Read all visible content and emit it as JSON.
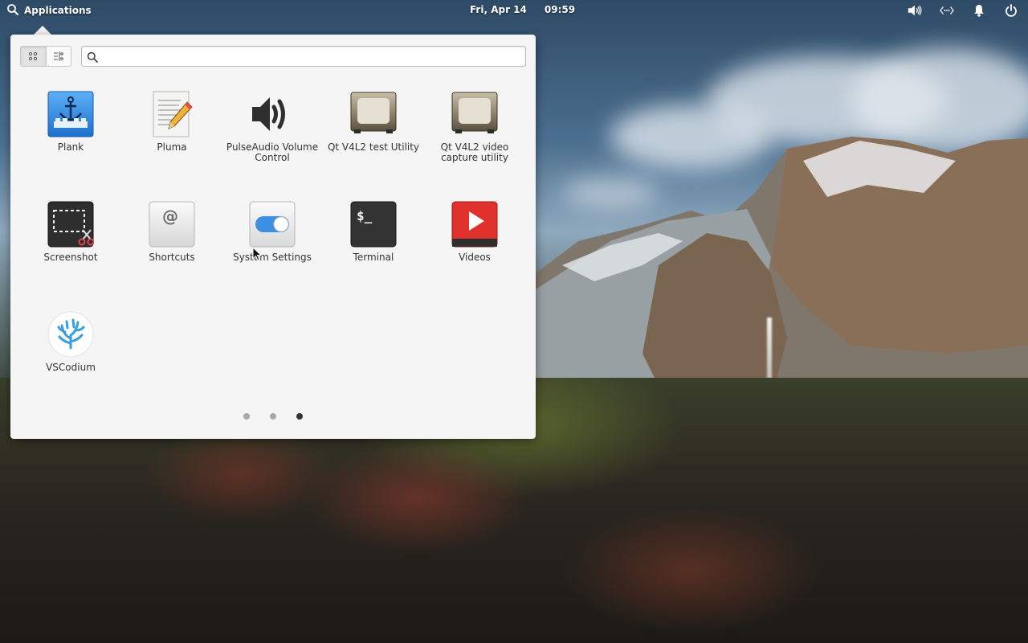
{
  "panel": {
    "applications_label": "Applications",
    "date": "Fri, Apr 14",
    "time": "09:59",
    "indicators": [
      "speaker-icon",
      "network-icon",
      "bell-icon",
      "power-icon"
    ]
  },
  "menu": {
    "view_modes": [
      "grid-view-icon",
      "category-view-icon"
    ],
    "active_view": "grid",
    "search": {
      "value": "",
      "placeholder": ""
    },
    "apps": [
      {
        "label": "Plank",
        "icon": "plank-icon"
      },
      {
        "label": "Pluma",
        "icon": "pluma-icon"
      },
      {
        "label": "PulseAudio Volume Control",
        "icon": "speaker-icon"
      },
      {
        "label": "Qt V4L2 test Utility",
        "icon": "webcam-icon"
      },
      {
        "label": "Qt V4L2 video capture utility",
        "icon": "webcam-icon"
      },
      {
        "label": "Screenshot",
        "icon": "screenshot-icon"
      },
      {
        "label": "Shortcuts",
        "icon": "at-sign-icon"
      },
      {
        "label": "System Settings",
        "icon": "toggle-switch-icon"
      },
      {
        "label": "Terminal",
        "icon": "terminal-icon"
      },
      {
        "label": "Videos",
        "icon": "video-play-icon"
      },
      {
        "label": "VSCodium",
        "icon": "vscodium-icon"
      }
    ],
    "pages": {
      "total": 3,
      "current": 3
    }
  },
  "colors": {
    "menu_bg": "#f5f5f5",
    "label_text": "#333333",
    "videos_red": "#e0302c",
    "plank_blue": "#3a8ee6",
    "toggle_blue": "#3d8fe3",
    "vscodium_blue": "#3a9ee4"
  }
}
